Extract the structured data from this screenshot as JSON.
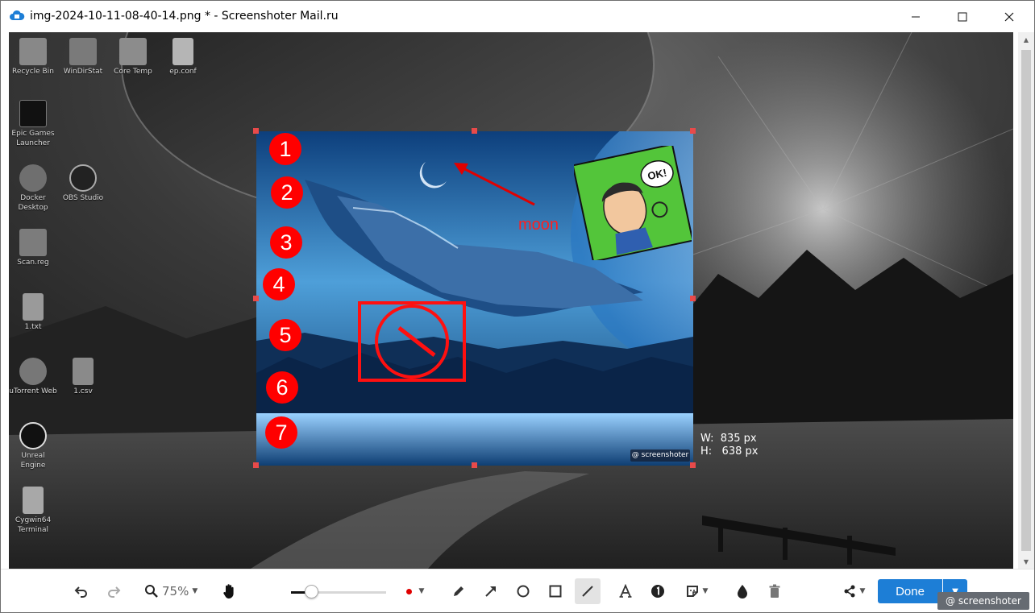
{
  "window": {
    "title": "img-2024-10-11-08-40-14.png * - Screenshoter Mail.ru",
    "controls": {
      "minimize": "minimize-icon",
      "maximize": "maximize-icon",
      "close": "close-icon"
    }
  },
  "desktop": {
    "icons": [
      {
        "label": "Recycle Bin",
        "icon": "recycle-bin-icon"
      },
      {
        "label": "WinDirStat",
        "icon": "windirstat-icon"
      },
      {
        "label": "Core Temp",
        "icon": "core-temp-icon"
      },
      {
        "label": "ep.conf",
        "icon": "file-icon"
      },
      {
        "label": "Epic Games Launcher",
        "icon": "epic-games-icon"
      },
      {
        "label": "Docker Desktop",
        "icon": "docker-icon"
      },
      {
        "label": "OBS Studio",
        "icon": "obs-icon"
      },
      {
        "label": "Scan.reg",
        "icon": "reg-file-icon"
      },
      {
        "label": "1.txt",
        "icon": "text-file-icon"
      },
      {
        "label": "uTorrent Web",
        "icon": "utorrent-icon"
      },
      {
        "label": "1.csv",
        "icon": "csv-file-icon"
      },
      {
        "label": "Unreal Engine",
        "icon": "unreal-engine-icon"
      },
      {
        "label": "Cygwin64 Terminal",
        "icon": "cygwin-icon"
      }
    ]
  },
  "annotations": {
    "numbers": [
      "1",
      "2",
      "3",
      "4",
      "5",
      "6",
      "7"
    ],
    "moon_label": "moon",
    "sticker_text": "OK!",
    "watermark": "@ screenshoter",
    "color": "#ff0000"
  },
  "selection": {
    "width_label": "W:  835 px",
    "height_label": "H:   638 px"
  },
  "toolbar": {
    "zoom": "75%",
    "done_label": "Done",
    "active_tool": "line",
    "color": "#e00000",
    "tools": [
      "undo-icon",
      "redo-icon",
      "zoom-icon",
      "hand-icon",
      "brush-size-slider",
      "color-picker",
      "pencil-icon",
      "arrow-icon",
      "ellipse-icon",
      "rectangle-icon",
      "line-icon",
      "text-icon",
      "number-icon",
      "sticker-icon",
      "blur-icon",
      "delete-icon",
      "share-icon"
    ]
  },
  "brand": "@ screenshoter"
}
